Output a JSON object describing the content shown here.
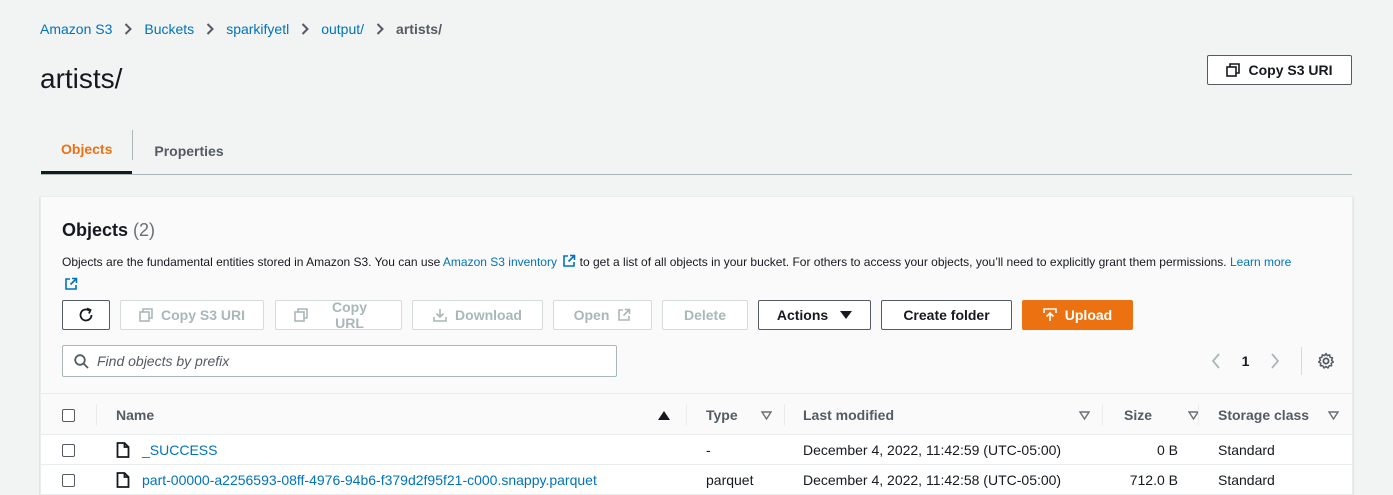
{
  "breadcrumb": {
    "items": [
      "Amazon S3",
      "Buckets",
      "sparkifyetl",
      "output/"
    ],
    "current": "artists/"
  },
  "page": {
    "title": "artists/",
    "copy_uri_label": "Copy S3 URI"
  },
  "tabs": [
    "Objects",
    "Properties"
  ],
  "objects_panel": {
    "title": "Objects",
    "count": "(2)",
    "description_pre": "Objects are the fundamental entities stored in Amazon S3. You can use ",
    "inventory_link": "Amazon S3 inventory",
    "description_mid": " to get a list of all objects in your bucket. For others to access your objects, you’ll need to explicitly grant them permissions. ",
    "learn_more_link": "Learn more"
  },
  "toolbar": {
    "copy_s3_uri": "Copy S3 URI",
    "copy_url": "Copy URL",
    "download": "Download",
    "open": "Open",
    "delete": "Delete",
    "actions": "Actions",
    "create_folder": "Create folder",
    "upload": "Upload"
  },
  "search": {
    "placeholder": "Find objects by prefix",
    "value": ""
  },
  "pagination": {
    "current_page": "1"
  },
  "table": {
    "columns": [
      "Name",
      "Type",
      "Last modified",
      "Size",
      "Storage class"
    ],
    "rows": [
      {
        "name": "_SUCCESS",
        "type": "-",
        "last_modified": "December 4, 2022, 11:42:59 (UTC-05:00)",
        "size": "0 B",
        "storage_class": "Standard"
      },
      {
        "name": "part-00000-a2256593-08ff-4976-94b6-f379d2f95f21-c000.snappy.parquet",
        "type": "parquet",
        "last_modified": "December 4, 2022, 11:42:58 (UTC-05:00)",
        "size": "712.0 B",
        "storage_class": "Standard"
      }
    ]
  },
  "colors": {
    "accent": "#ec7211",
    "link": "#0073bb",
    "text": "#16191f",
    "muted": "#545b64"
  }
}
